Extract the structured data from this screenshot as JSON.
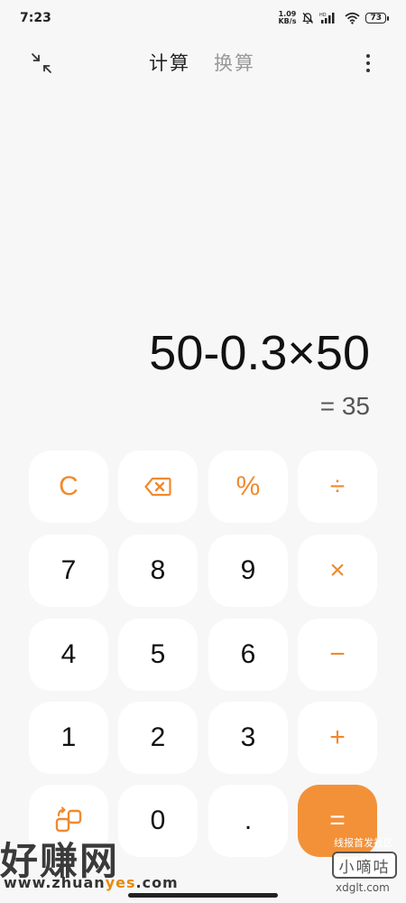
{
  "status_bar": {
    "time": "7:23",
    "net_speed_value": "1.09",
    "net_speed_unit": "KB/s",
    "battery": "73",
    "icons": [
      "mute-icon",
      "signal-icon",
      "wifi-icon"
    ]
  },
  "top_bar": {
    "tabs": [
      {
        "label": "计算",
        "active": true
      },
      {
        "label": "换算",
        "active": false
      }
    ]
  },
  "display": {
    "expression": "50-0.3×50",
    "result": "= 35"
  },
  "keypad": {
    "row1": [
      "C",
      "⌫",
      "%",
      "÷"
    ],
    "row2": [
      "7",
      "8",
      "9",
      "×"
    ],
    "row3": [
      "4",
      "5",
      "6",
      "−"
    ],
    "row4": [
      "1",
      "2",
      "3",
      "+"
    ],
    "row5": [
      "switch-mode",
      "0",
      ".",
      "="
    ]
  },
  "colors": {
    "accent": "#f08a2e",
    "equals_bg": "#f39139",
    "background": "#f7f7f7",
    "key_bg": "#ffffff"
  },
  "watermark": {
    "left_text": "好赚网",
    "left_url_prefix": "www.zhuan",
    "left_url_yes": "yes",
    "left_url_suffix": ".com",
    "right_top": "线报首发社区",
    "right_box": "小嘀咕",
    "right_url": "xdglt.com"
  }
}
